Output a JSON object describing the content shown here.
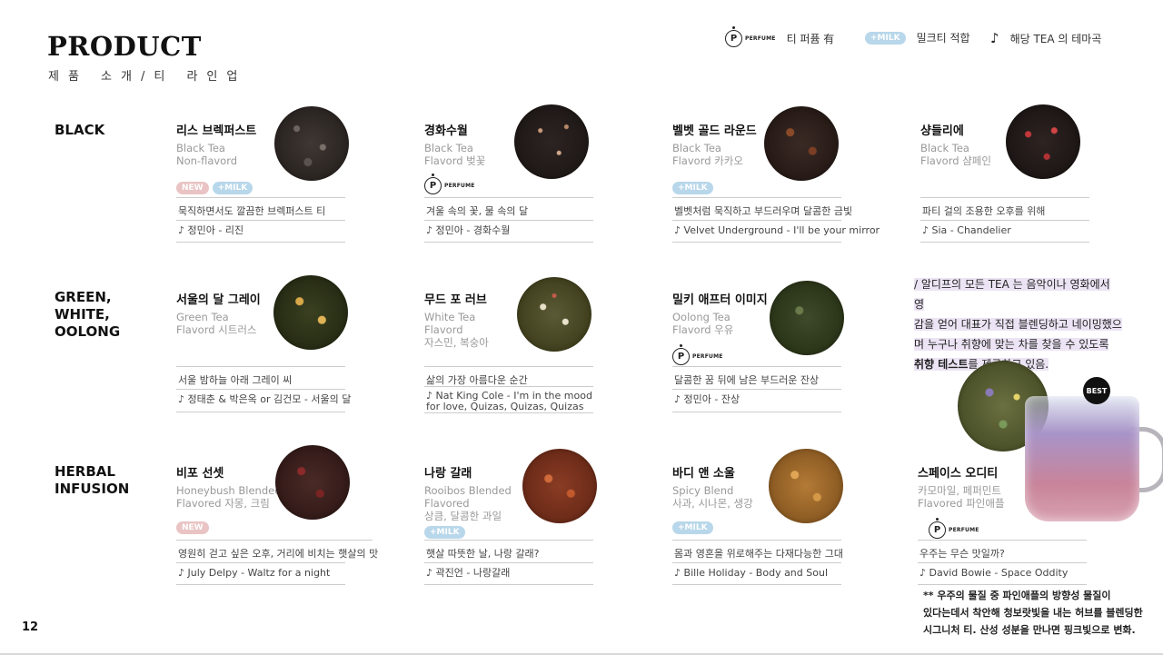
{
  "header": {
    "title": "PRODUCT",
    "subtitle": "제품 소개/티 라인업",
    "legend": {
      "perfume_symbol": "P",
      "perfume_text": "PERFUME",
      "perfume_label": "티 퍼퓸 有",
      "milk_badge": "+MILK",
      "milk_label": "밀크티 적합",
      "note_symbol": "♪",
      "note_label": "해당 TEA 의 테마곡"
    }
  },
  "categories": {
    "black": "BLACK",
    "green": "GREEN,\nWHITE,\nOOLONG",
    "herbal": "HERBAL\nINFUSION"
  },
  "products": [
    {
      "name": "리스 브렉퍼스트",
      "sub": [
        "Black Tea",
        "Non-flavord"
      ],
      "tags": [
        "NEW",
        "+MILK"
      ],
      "description": "묵직하면서도 깔끔한 브렉퍼스트 티",
      "song": "♪ 정민아 - 리진"
    },
    {
      "name": "경화수월",
      "sub": [
        "Black Tea",
        "Flavord 벚꽃"
      ],
      "tags": [
        "PERFUME"
      ],
      "description": "겨울 속의 꽃, 물 속의 달",
      "song": "♪ 정민아 - 경화수월"
    },
    {
      "name": "벨벳 골드 라운드",
      "sub": [
        "Black Tea",
        "Flavord 카카오"
      ],
      "tags": [
        "+MILK"
      ],
      "description": "벨벳처럼 묵직하고 부드러우며 달콤한 금빛",
      "song": "♪  Velvet Underground - I'll be your mirror"
    },
    {
      "name": "샹들리에",
      "sub": [
        "Black Tea",
        "Flavord 샴페인"
      ],
      "tags": [],
      "description": "파티 걸의 조용한 오후를 위해",
      "song": "♪ Sia - Chandelier"
    },
    {
      "name": "서울의 달 그레이",
      "sub": [
        "Green Tea",
        "Flavord 시트러스"
      ],
      "tags": [],
      "description": "서울 밤하늘 아래 그레이 씨",
      "song": "♪ 정태춘 & 박은옥 or 김건모 - 서울의 달"
    },
    {
      "name": "무드 포 러브",
      "sub": [
        "White Tea",
        "Flavord",
        "자스민, 복숭아"
      ],
      "tags": [],
      "description": "삶의 가장 아름다운 순간",
      "song": "♪ Nat King Cole - I'm in the mood\nfor love, Quizas, Quizas, Quizas"
    },
    {
      "name": "밀키 애프터 이미지",
      "sub": [
        "Oolong Tea",
        "Flavord 우유"
      ],
      "tags": [
        "PERFUME"
      ],
      "description": "달콤한 꿈 뒤에 남은 부드러운 잔상",
      "song": "♪ 정민아 - 잔상"
    },
    {
      "name": "비포 선셋",
      "sub": [
        "Honeybush Blended",
        "Flavored 자몽, 크림"
      ],
      "tags": [
        "NEW"
      ],
      "description": "영원히 걷고 싶은 오후, 거리에 비치는 햇살의 맛",
      "song": "♪ July Delpy - Waltz for a night"
    },
    {
      "name": "나랑 갈래",
      "sub": [
        "Rooibos Blended",
        "Flavored",
        "상큼, 달콤한 과일"
      ],
      "tags": [
        "+MILK"
      ],
      "description": "햇살 따뜻한 날, 나랑 갈래?",
      "song": "♪ 곽진언 - 나랑갈래"
    },
    {
      "name": "바디 앤 소울",
      "sub": [
        "Spicy Blend",
        "사과, 시나몬, 생강"
      ],
      "tags": [
        "+MILK"
      ],
      "description": "몸과 영혼을 위로해주는 다재다능한 그대",
      "song": "♪ Bille Holiday - Body and Soul"
    },
    {
      "name": "스페이스 오디티",
      "sub": [
        "카모마일, 페퍼민트",
        "Flavored 파인애플"
      ],
      "tags": [
        "PERFUME"
      ],
      "description": "우주는 무슨 맛일까?",
      "song": "♪ David Bowie - Space Oddity"
    }
  ],
  "intro": {
    "line1": "/ 알디프의 모든 TEA 는 음악이나 영화에서 영",
    "line2": "감을 얻어 대표가 직접 블렌딩하고 네이밍했으",
    "line3": "며 누구나 취향에 맞는 차를 찾을 수 있도록",
    "line4_strong": "취향 테스트",
    "line4_rest": "를 제공하고 있음."
  },
  "best_badge": "BEST",
  "footnote": {
    "line1": "** 우주의 물질 중 파인애플의 방향성 물질이",
    "line2": "있다는데서 착안해 청보랏빛을 내는 허브를 블렌딩한",
    "line3": "시그니처 티. 산성 성분을 만나면 핑크빛으로 변화."
  },
  "page_number": "12",
  "colors": {
    "milk_badge": "#b8d7ea",
    "new_badge": "#eac4c4",
    "intro_highlight": "#ece4f4"
  }
}
